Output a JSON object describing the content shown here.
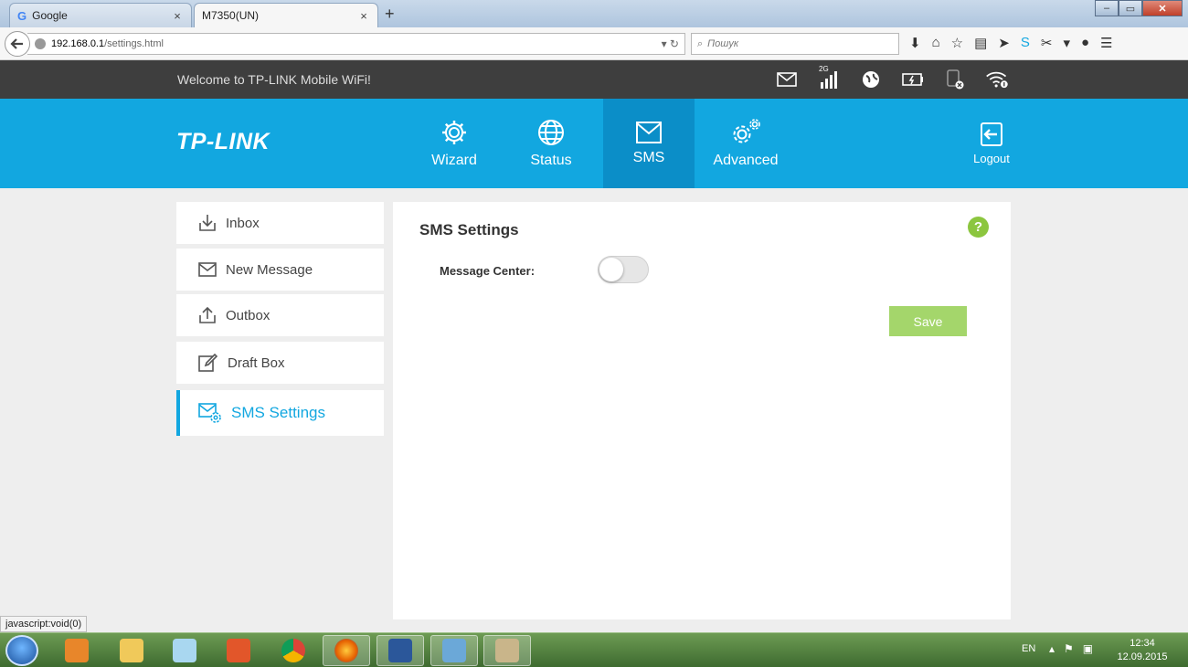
{
  "browser": {
    "tabs": [
      {
        "label": "Google",
        "close": "×"
      },
      {
        "label": "M7350(UN)",
        "close": "×"
      }
    ],
    "new_tab": "+",
    "window_controls": {
      "minimize": "–",
      "maximize": "▭",
      "close": "✕"
    },
    "url": {
      "host": "192.168.0.1",
      "path": "/settings.html"
    },
    "search_placeholder": "Пошук",
    "status_text": "javascript:void(0)"
  },
  "router": {
    "welcome": "Welcome to TP-LINK Mobile WiFi!",
    "network_type": "2G",
    "brand": "TP-LINK",
    "nav": {
      "wizard": "Wizard",
      "status": "Status",
      "sms": "SMS",
      "advanced": "Advanced",
      "logout": "Logout"
    },
    "sidebar": [
      {
        "label": "Inbox"
      },
      {
        "label": "New Message"
      },
      {
        "label": "Outbox"
      },
      {
        "label": "Draft Box"
      },
      {
        "label": "SMS Settings"
      }
    ],
    "content": {
      "title": "SMS Settings",
      "help": "?",
      "message_center_label": "Message Center:",
      "message_center_enabled": false,
      "save_label": "Save"
    },
    "colors": {
      "accent": "#12a7e0",
      "save": "#a4d66b",
      "help": "#8cc63f",
      "topbar": "#3e3e3e"
    }
  },
  "taskbar": {
    "language": "EN",
    "time": "12:34",
    "date": "12.09.2015"
  }
}
